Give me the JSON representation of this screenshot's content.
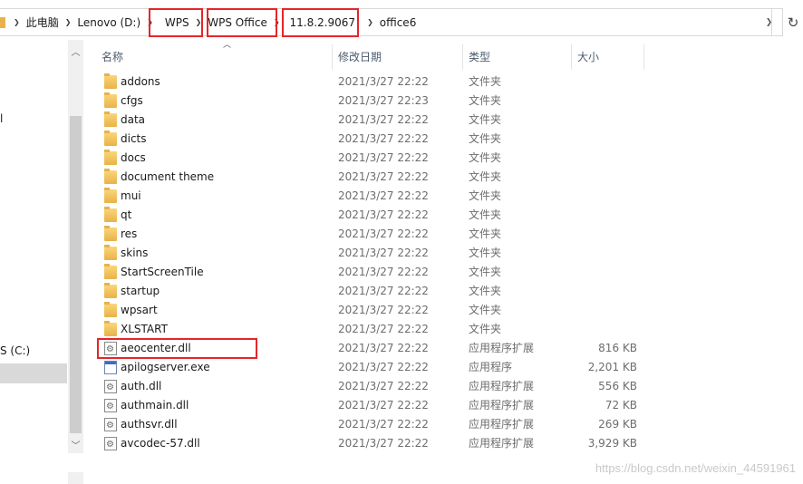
{
  "address": {
    "crumbs": [
      "此电脑",
      "Lenovo (D:)",
      "WPS",
      "WPS Office",
      "11.8.2.9067",
      "office6"
    ],
    "dropdown_icon": "chevron-down-icon",
    "refresh_icon": "refresh-icon"
  },
  "nav": {
    "fragments": [
      "l",
      "S (C:)"
    ]
  },
  "columns": {
    "name": "名称",
    "date": "修改日期",
    "type": "类型",
    "size": "大小"
  },
  "files": [
    {
      "name": "addons",
      "date": "2021/3/27 22:22",
      "type": "文件夹",
      "size": "",
      "icon": "folder"
    },
    {
      "name": "cfgs",
      "date": "2021/3/27 22:23",
      "type": "文件夹",
      "size": "",
      "icon": "folder"
    },
    {
      "name": "data",
      "date": "2021/3/27 22:22",
      "type": "文件夹",
      "size": "",
      "icon": "folder"
    },
    {
      "name": "dicts",
      "date": "2021/3/27 22:22",
      "type": "文件夹",
      "size": "",
      "icon": "folder"
    },
    {
      "name": "docs",
      "date": "2021/3/27 22:22",
      "type": "文件夹",
      "size": "",
      "icon": "folder"
    },
    {
      "name": "document theme",
      "date": "2021/3/27 22:22",
      "type": "文件夹",
      "size": "",
      "icon": "folder"
    },
    {
      "name": "mui",
      "date": "2021/3/27 22:22",
      "type": "文件夹",
      "size": "",
      "icon": "folder"
    },
    {
      "name": "qt",
      "date": "2021/3/27 22:22",
      "type": "文件夹",
      "size": "",
      "icon": "folder"
    },
    {
      "name": "res",
      "date": "2021/3/27 22:22",
      "type": "文件夹",
      "size": "",
      "icon": "folder"
    },
    {
      "name": "skins",
      "date": "2021/3/27 22:22",
      "type": "文件夹",
      "size": "",
      "icon": "folder"
    },
    {
      "name": "StartScreenTile",
      "date": "2021/3/27 22:22",
      "type": "文件夹",
      "size": "",
      "icon": "folder"
    },
    {
      "name": "startup",
      "date": "2021/3/27 22:22",
      "type": "文件夹",
      "size": "",
      "icon": "folder"
    },
    {
      "name": "wpsart",
      "date": "2021/3/27 22:22",
      "type": "文件夹",
      "size": "",
      "icon": "folder"
    },
    {
      "name": "XLSTART",
      "date": "2021/3/27 22:22",
      "type": "文件夹",
      "size": "",
      "icon": "folder"
    },
    {
      "name": "aeocenter.dll",
      "date": "2021/3/27 22:22",
      "type": "应用程序扩展",
      "size": "816 KB",
      "icon": "dll"
    },
    {
      "name": "apilogserver.exe",
      "date": "2021/3/27 22:22",
      "type": "应用程序",
      "size": "2,201 KB",
      "icon": "exe"
    },
    {
      "name": "auth.dll",
      "date": "2021/3/27 22:22",
      "type": "应用程序扩展",
      "size": "556 KB",
      "icon": "dll"
    },
    {
      "name": "authmain.dll",
      "date": "2021/3/27 22:22",
      "type": "应用程序扩展",
      "size": "72 KB",
      "icon": "dll"
    },
    {
      "name": "authsvr.dll",
      "date": "2021/3/27 22:22",
      "type": "应用程序扩展",
      "size": "269 KB",
      "icon": "dll"
    },
    {
      "name": "avcodec-57.dll",
      "date": "2021/3/27 22:22",
      "type": "应用程序扩展",
      "size": "3,929 KB",
      "icon": "dll"
    }
  ],
  "watermark": "https://blog.csdn.net/weixin_44591961",
  "colors": {
    "highlight": "#e4262c",
    "folder": "#e8b24a",
    "header_text": "#4d5b6e"
  }
}
